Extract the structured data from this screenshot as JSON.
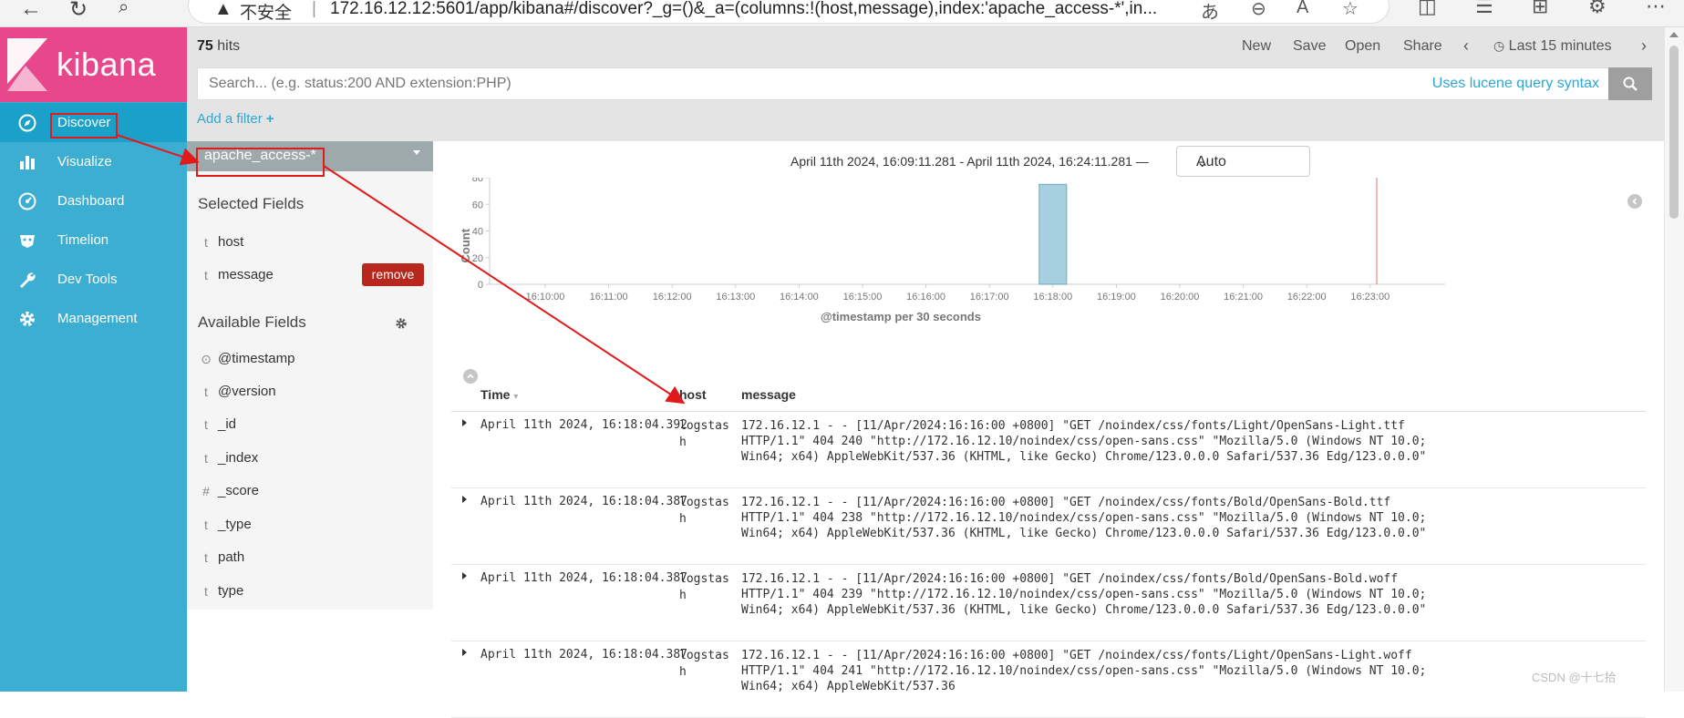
{
  "browser": {
    "insecure_label": "不安全",
    "separator": "|",
    "url": "172.16.12.12:5601/app/kibana#/discover?_g=()&_a=(columns:!(host,message),index:'apache_access-*',in..."
  },
  "app": {
    "logo_text": "kibana"
  },
  "sidebar": {
    "items": [
      {
        "label": "Discover",
        "icon": "compass-icon"
      },
      {
        "label": "Visualize",
        "icon": "bar-chart-icon"
      },
      {
        "label": "Dashboard",
        "icon": "dashboard-icon"
      },
      {
        "label": "Timelion",
        "icon": "timelion-icon"
      },
      {
        "label": "Dev Tools",
        "icon": "wrench-icon"
      },
      {
        "label": "Management",
        "icon": "gear-icon"
      }
    ]
  },
  "topbar": {
    "hits_count": "75",
    "hits_label": " hits",
    "actions": [
      "New",
      "Save",
      "Open",
      "Share"
    ],
    "time_range": "Last 15 minutes",
    "search_placeholder": "Search... (e.g. status:200 AND extension:PHP)",
    "lucene_link": "Uses lucene query syntax",
    "add_filter": "Add a filter",
    "add_filter_plus": "+"
  },
  "fields_panel": {
    "index_pattern": "apache_access-*",
    "selected_heading": "Selected Fields",
    "selected": [
      {
        "type": "t",
        "name": "host"
      },
      {
        "type": "t",
        "name": "message"
      }
    ],
    "remove_label": "remove",
    "available_heading": "Available Fields",
    "available": [
      {
        "type": "⊙",
        "name": "@timestamp"
      },
      {
        "type": "t",
        "name": "@version"
      },
      {
        "type": "t",
        "name": "_id"
      },
      {
        "type": "t",
        "name": "_index"
      },
      {
        "type": "#",
        "name": "_score"
      },
      {
        "type": "t",
        "name": "_type"
      },
      {
        "type": "t",
        "name": "path"
      },
      {
        "type": "t",
        "name": "type"
      }
    ]
  },
  "main": {
    "range_text": "April 11th 2024, 16:09:11.281 - April 11th 2024, 16:24:11.281 —",
    "interval": "Auto"
  },
  "chart_data": {
    "type": "bar",
    "categories": [
      "16:10:00",
      "16:11:00",
      "16:12:00",
      "16:13:00",
      "16:14:00",
      "16:15:00",
      "16:16:00",
      "16:17:00",
      "16:18:00",
      "16:19:00",
      "16:20:00",
      "16:21:00",
      "16:22:00",
      "16:23:00"
    ],
    "bars": [
      {
        "x": "16:18:00",
        "value": 75
      }
    ],
    "xlabel": "@timestamp per 30 seconds",
    "ylabel": "Count",
    "ylim": [
      0,
      80
    ],
    "yticks": [
      0,
      20,
      40,
      60,
      80
    ],
    "colors": {
      "bar": "#a6d0df",
      "bar_stroke": "#6fa9c0"
    }
  },
  "table": {
    "headers": {
      "time": "Time",
      "host": "host",
      "message": "message"
    },
    "rows": [
      {
        "time": "April 11th 2024, 16:18:04.392",
        "host": "logstash",
        "message": "172.16.12.1 - - [11/Apr/2024:16:16:00 +0800] \"GET /noindex/css/fonts/Light/OpenSans-Light.ttf HTTP/1.1\" 404 240 \"http://172.16.12.10/noindex/css/open-sans.css\" \"Mozilla/5.0 (Windows NT 10.0; Win64; x64) AppleWebKit/537.36 (KHTML, like Gecko) Chrome/123.0.0.0 Safari/537.36 Edg/123.0.0.0\""
      },
      {
        "time": "April 11th 2024, 16:18:04.387",
        "host": "logstash",
        "message": "172.16.12.1 - - [11/Apr/2024:16:16:00 +0800] \"GET /noindex/css/fonts/Bold/OpenSans-Bold.ttf HTTP/1.1\" 404 238 \"http://172.16.12.10/noindex/css/open-sans.css\" \"Mozilla/5.0 (Windows NT 10.0; Win64; x64) AppleWebKit/537.36 (KHTML, like Gecko) Chrome/123.0.0.0 Safari/537.36 Edg/123.0.0.0\""
      },
      {
        "time": "April 11th 2024, 16:18:04.387",
        "host": "logstash",
        "message": "172.16.12.1 - - [11/Apr/2024:16:16:00 +0800] \"GET /noindex/css/fonts/Bold/OpenSans-Bold.woff HTTP/1.1\" 404 239 \"http://172.16.12.10/noindex/css/open-sans.css\" \"Mozilla/5.0 (Windows NT 10.0; Win64; x64) AppleWebKit/537.36 (KHTML, like Gecko) Chrome/123.0.0.0 Safari/537.36 Edg/123.0.0.0\""
      },
      {
        "time": "April 11th 2024, 16:18:04.387",
        "host": "logstash",
        "message": "172.16.12.1 - - [11/Apr/2024:16:16:00 +0800] \"GET /noindex/css/fonts/Light/OpenSans-Light.woff HTTP/1.1\" 404 241 \"http://172.16.12.10/noindex/css/open-sans.css\" \"Mozilla/5.0 (Windows NT 10.0; Win64; x64) AppleWebKit/537.36"
      }
    ]
  },
  "watermark": "CSDN @十七拾",
  "colors": {
    "sidebar": "#3caed2",
    "sidebar_active": "#1ba0c9",
    "logo_bg": "#e8478b",
    "link": "#2ea7d2",
    "remove": "#b8271b",
    "annotation": "#e01b1b"
  }
}
